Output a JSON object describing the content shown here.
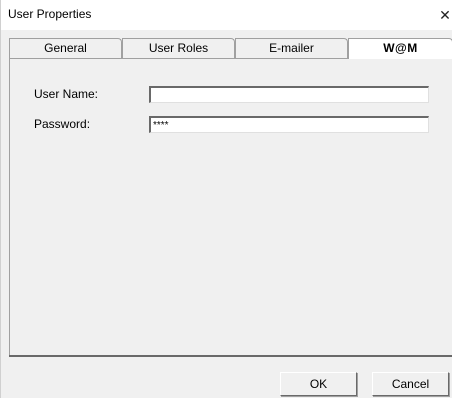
{
  "window": {
    "title": "User Properties",
    "close_glyph": "✕"
  },
  "tabs": [
    {
      "label": "General",
      "active": false
    },
    {
      "label": "User Roles",
      "active": false
    },
    {
      "label": "E-mailer",
      "active": false
    },
    {
      "label": "W@M",
      "active": true
    }
  ],
  "form": {
    "user_name": {
      "label": "User Name:",
      "value": ""
    },
    "password": {
      "label": "Password:",
      "value": "****"
    }
  },
  "buttons": {
    "ok_label": "OK",
    "cancel_label": "Cancel"
  },
  "colors": {
    "window_bg": "#f0f0f0",
    "titlebar_bg": "#ffffff",
    "border_dark": "#696969"
  }
}
